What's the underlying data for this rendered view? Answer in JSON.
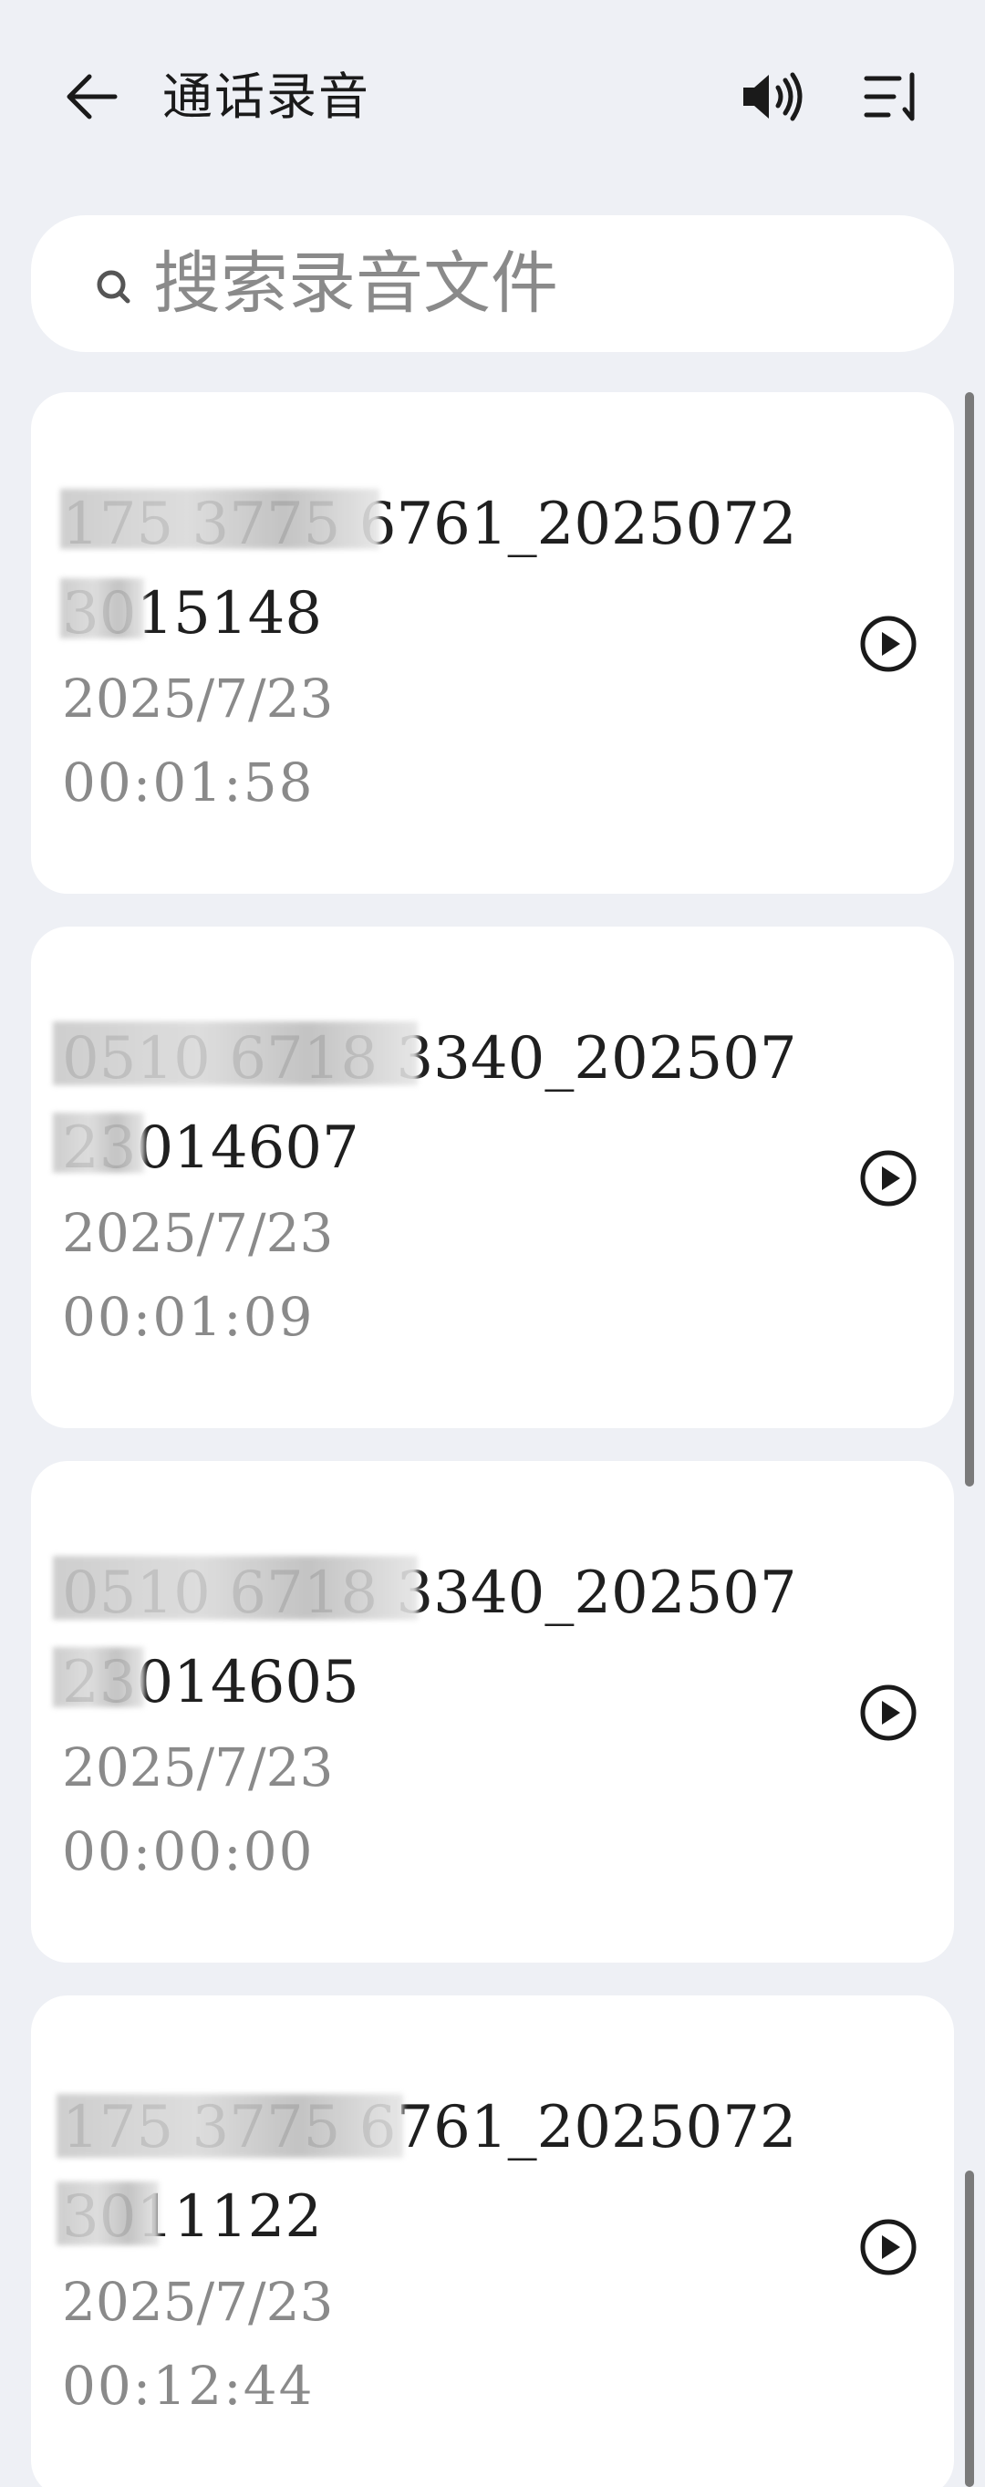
{
  "header": {
    "title": "通话录音",
    "back_icon": "back-arrow-icon",
    "speaker_icon": "speaker-icon",
    "sort_icon": "sort-icon"
  },
  "search": {
    "placeholder": "搜索录音文件",
    "icon": "search-icon"
  },
  "recordings": [
    {
      "name": "175 3775 6761_20250723015148",
      "date": "2025/7/23",
      "duration": "00:01:58"
    },
    {
      "name": "0510 6718 3340_20250723014607",
      "date": "2025/7/23",
      "duration": "00:01:09"
    },
    {
      "name": "0510 6718 3340_20250723014605",
      "date": "2025/7/23",
      "duration": "00:00:00"
    },
    {
      "name": "175 3775 6761_20250723011122",
      "date": "2025/7/23",
      "duration": "00:12:44"
    }
  ],
  "colors": {
    "background": "#eef0f5",
    "card": "#ffffff",
    "primary_text": "#1f1f1f",
    "secondary_text": "#8a8a8a"
  }
}
